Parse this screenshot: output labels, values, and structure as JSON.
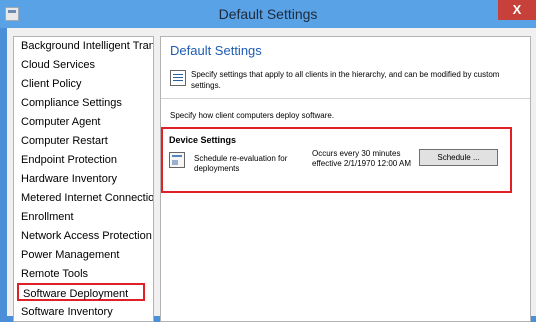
{
  "window": {
    "title": "Default Settings",
    "close_label": "X"
  },
  "sidebar": {
    "items": [
      {
        "label": "Background Intelligent Tran"
      },
      {
        "label": "Cloud Services"
      },
      {
        "label": "Client Policy"
      },
      {
        "label": "Compliance Settings"
      },
      {
        "label": "Computer Agent"
      },
      {
        "label": "Computer Restart"
      },
      {
        "label": "Endpoint Protection"
      },
      {
        "label": "Hardware Inventory"
      },
      {
        "label": "Metered Internet Connectio"
      },
      {
        "label": "Enrollment"
      },
      {
        "label": "Network Access Protection"
      },
      {
        "label": "Power Management"
      },
      {
        "label": "Remote Tools"
      },
      {
        "label": "Software Deployment"
      },
      {
        "label": "Software Inventory"
      }
    ],
    "selected": "Software Deployment"
  },
  "main": {
    "heading": "Default Settings",
    "description": "Specify settings that apply to all clients in the hierarchy, and can be modified by custom settings.",
    "deploy_text": "Specify how client computers deploy software.",
    "section": {
      "title": "Device Settings",
      "setting_label": "Schedule re-evaluation for deployments",
      "setting_value": "Occurs every 30 minutes effective 2/1/1970 12:00 AM",
      "button_label": "Schedule ..."
    }
  },
  "colors": {
    "accent_title": "#1e5bb0",
    "highlight": "#e01f26",
    "titlebar": "#5aa2e6"
  }
}
